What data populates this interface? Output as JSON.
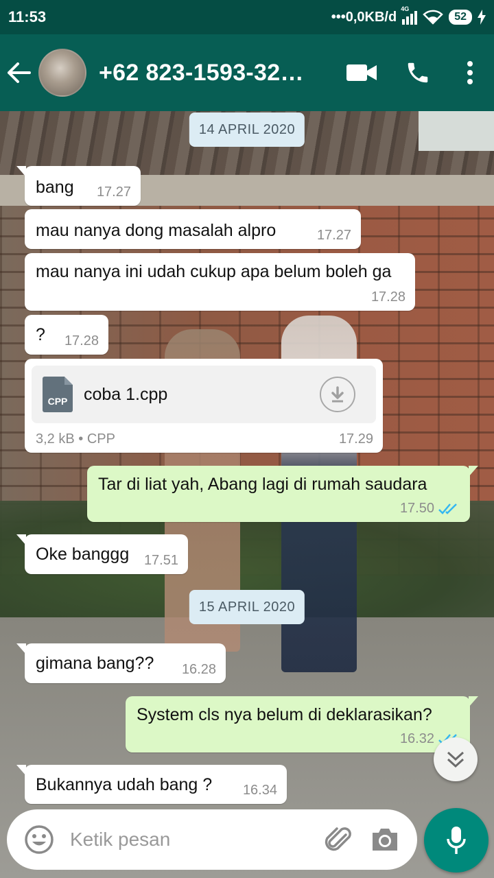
{
  "status": {
    "time": "11:53",
    "network": "•••0,0KB/d",
    "net_badge": "4G",
    "battery": "52"
  },
  "header": {
    "contact": "+62 823-1593-32…"
  },
  "messages": [
    {
      "kind": "date",
      "label": "14 APRIL 2020"
    },
    {
      "kind": "in",
      "text": "bang",
      "time": "17.27"
    },
    {
      "kind": "in",
      "text": "mau nanya dong masalah alpro",
      "time": "17.27"
    },
    {
      "kind": "in",
      "text": "mau nanya ini udah cukup apa belum boleh ga",
      "time": "17.28"
    },
    {
      "kind": "in",
      "text": "?",
      "time": "17.28"
    },
    {
      "kind": "file",
      "file_type": "CPP",
      "name": "coba 1.cpp",
      "meta": "3,2 kB • CPP",
      "time": "17.29"
    },
    {
      "kind": "out",
      "text": "Tar di liat yah, Abang lagi di rumah saudara",
      "time": "17.50",
      "ticks": "read"
    },
    {
      "kind": "in",
      "text": "Oke banggg",
      "time": "17.51"
    },
    {
      "kind": "date",
      "label": "15 APRIL 2020"
    },
    {
      "kind": "in",
      "text": "gimana bang??",
      "time": "16.28"
    },
    {
      "kind": "out",
      "text": "System cls nya belum di deklarasikan?",
      "time": "16.32",
      "ticks": "read"
    },
    {
      "kind": "in",
      "text": "Bukannya udah bang ?",
      "time": "16.34"
    }
  ],
  "input": {
    "placeholder": "Ketik pesan"
  },
  "colors": {
    "header": "#075e54",
    "statusbar": "#054d44",
    "outgoing": "#dcf8c6",
    "read_tick": "#34b7f1",
    "fab": "#00897b"
  },
  "icons": [
    "back-arrow-icon",
    "video-call-icon",
    "phone-icon",
    "more-vert-icon",
    "download-icon",
    "double-check-icon",
    "scroll-down-icon",
    "emoji-icon",
    "attach-icon",
    "camera-icon",
    "mic-icon"
  ]
}
